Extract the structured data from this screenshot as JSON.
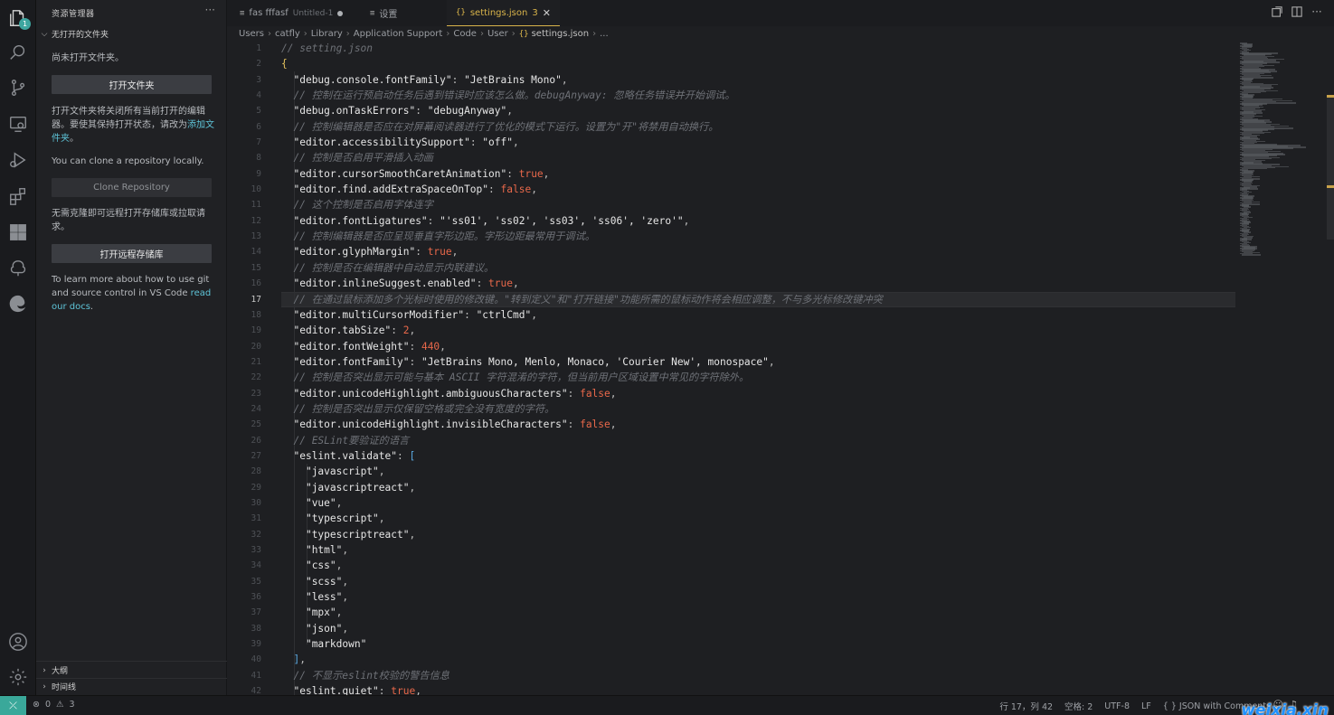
{
  "activity": {
    "explorer_badge": "1",
    "icons": [
      "files-icon",
      "search-icon",
      "source-control-icon",
      "remote-explorer-icon",
      "run-debug-icon",
      "extensions-icon",
      "grid-icon",
      "tree-icon",
      "edge-icon",
      "account-icon",
      "settings-gear-icon"
    ]
  },
  "sidebar": {
    "title": "资源管理器",
    "more": "···",
    "section_title": "无打开的文件夹",
    "no_folder_text": "尚未打开文件夹。",
    "open_folder_btn": "打开文件夹",
    "close_editors_text": "打开文件夹将关闭所有当前打开的编辑器。要使其保持打开状态，请改为",
    "add_folder_link": "添加文件夹",
    "add_folder_suffix": "。",
    "clone_text": "You can clone a repository locally.",
    "clone_btn": "Clone Repository",
    "remote_text": "无需克隆即可远程打开存储库或拉取请求。",
    "remote_btn": "打开远程存储库",
    "learn_text": "To learn more about how to use git and source control in VS Code",
    "read_docs_link": "read our docs",
    "learn_suffix": ".",
    "outline": "大纲",
    "timeline": "时间线"
  },
  "tabs": [
    {
      "icon": "≡",
      "label": "fas fffasf",
      "desc": "Untitled-1",
      "dirty": true
    },
    {
      "icon": "≡",
      "label": "设置"
    },
    {
      "icon": "{}",
      "label": "settings.json",
      "desc": "3",
      "close": "✕"
    }
  ],
  "breadcrumb": {
    "items": [
      "Users",
      "catfly",
      "Library",
      "Application Support",
      "Code",
      "User"
    ],
    "file_icon": "{}",
    "file": "settings.json",
    "tail": "..."
  },
  "editor": {
    "current_line": 17,
    "first_line": 1,
    "lines": [
      [
        [
          "c",
          "// setting.json"
        ]
      ],
      [
        [
          "br",
          "{"
        ]
      ],
      [
        [
          "p",
          "  "
        ],
        [
          "k",
          "\"debug.console.fontFamily\""
        ],
        [
          "p",
          ": "
        ],
        [
          "s",
          "\"JetBrains Mono\""
        ],
        [
          "p",
          ","
        ]
      ],
      [
        [
          "p",
          "  "
        ],
        [
          "c",
          "// 控制在运行预启动任务后遇到错误时应该怎么做。debugAnyway: 忽略任务错误并开始调试。"
        ]
      ],
      [
        [
          "p",
          "  "
        ],
        [
          "k",
          "\"debug.onTaskErrors\""
        ],
        [
          "p",
          ": "
        ],
        [
          "s",
          "\"debugAnyway\""
        ],
        [
          "p",
          ","
        ]
      ],
      [
        [
          "p",
          "  "
        ],
        [
          "c",
          "// 控制编辑器是否应在对屏幕阅读器进行了优化的模式下运行。设置为\"开\"将禁用自动换行。"
        ]
      ],
      [
        [
          "p",
          "  "
        ],
        [
          "k",
          "\"editor.accessibilitySupport\""
        ],
        [
          "p",
          ": "
        ],
        [
          "s",
          "\"off\""
        ],
        [
          "p",
          ","
        ]
      ],
      [
        [
          "p",
          "  "
        ],
        [
          "c",
          "// 控制是否启用平滑插入动画"
        ]
      ],
      [
        [
          "p",
          "  "
        ],
        [
          "k",
          "\"editor.cursorSmoothCaretAnimation\""
        ],
        [
          "p",
          ": "
        ],
        [
          "b",
          "true"
        ],
        [
          "p",
          ","
        ]
      ],
      [
        [
          "p",
          "  "
        ],
        [
          "k",
          "\"editor.find.addExtraSpaceOnTop\""
        ],
        [
          "p",
          ": "
        ],
        [
          "b",
          "false"
        ],
        [
          "p",
          ","
        ]
      ],
      [
        [
          "p",
          "  "
        ],
        [
          "c",
          "// 这个控制是否启用字体连字"
        ]
      ],
      [
        [
          "p",
          "  "
        ],
        [
          "k",
          "\"editor.fontLigatures\""
        ],
        [
          "p",
          ": "
        ],
        [
          "s",
          "\"'ss01', 'ss02', 'ss03', 'ss06', 'zero'\""
        ],
        [
          "p",
          ","
        ]
      ],
      [
        [
          "p",
          "  "
        ],
        [
          "c",
          "// 控制编辑器是否应呈现垂直字形边距。字形边距最常用于调试。"
        ]
      ],
      [
        [
          "p",
          "  "
        ],
        [
          "k",
          "\"editor.glyphMargin\""
        ],
        [
          "p",
          ": "
        ],
        [
          "b",
          "true"
        ],
        [
          "p",
          ","
        ]
      ],
      [
        [
          "p",
          "  "
        ],
        [
          "c",
          "// 控制是否在编辑器中自动显示内联建议。"
        ]
      ],
      [
        [
          "p",
          "  "
        ],
        [
          "k",
          "\"editor.inlineSuggest.enabled\""
        ],
        [
          "p",
          ": "
        ],
        [
          "b",
          "true"
        ],
        [
          "p",
          ","
        ]
      ],
      [
        [
          "p",
          "  "
        ],
        [
          "c",
          "// 在通过鼠标添加多个光标时使用的修改键。\"转到定义\"和\"打开链接\"功能所需的鼠标动作将会相应调整，不与多光标修改键冲突"
        ]
      ],
      [
        [
          "p",
          "  "
        ],
        [
          "k",
          "\"editor.multiCursorModifier\""
        ],
        [
          "p",
          ": "
        ],
        [
          "s",
          "\"ctrlCmd\""
        ],
        [
          "p",
          ","
        ]
      ],
      [
        [
          "p",
          "  "
        ],
        [
          "k",
          "\"editor.tabSize\""
        ],
        [
          "p",
          ": "
        ],
        [
          "n",
          "2"
        ],
        [
          "p",
          ","
        ]
      ],
      [
        [
          "p",
          "  "
        ],
        [
          "k",
          "\"editor.fontWeight\""
        ],
        [
          "p",
          ": "
        ],
        [
          "n",
          "440"
        ],
        [
          "p",
          ","
        ]
      ],
      [
        [
          "p",
          "  "
        ],
        [
          "k",
          "\"editor.fontFamily\""
        ],
        [
          "p",
          ": "
        ],
        [
          "s",
          "\"JetBrains Mono, Menlo, Monaco, 'Courier New', monospace\""
        ],
        [
          "p",
          ","
        ]
      ],
      [
        [
          "p",
          "  "
        ],
        [
          "c",
          "// 控制是否突出显示可能与基本 ASCII 字符混淆的字符，但当前用户区域设置中常见的字符除外。"
        ]
      ],
      [
        [
          "p",
          "  "
        ],
        [
          "k",
          "\"editor.unicodeHighlight.ambiguousCharacters\""
        ],
        [
          "p",
          ": "
        ],
        [
          "b",
          "false"
        ],
        [
          "p",
          ","
        ]
      ],
      [
        [
          "p",
          "  "
        ],
        [
          "c",
          "// 控制是否突出显示仅保留空格或完全没有宽度的字符。"
        ]
      ],
      [
        [
          "p",
          "  "
        ],
        [
          "k",
          "\"editor.unicodeHighlight.invisibleCharacters\""
        ],
        [
          "p",
          ": "
        ],
        [
          "b",
          "false"
        ],
        [
          "p",
          ","
        ]
      ],
      [
        [
          "p",
          "  "
        ],
        [
          "c",
          "// ESLint要验证的语言"
        ]
      ],
      [
        [
          "p",
          "  "
        ],
        [
          "k",
          "\"eslint.validate\""
        ],
        [
          "p",
          ": "
        ],
        [
          "br2",
          "["
        ]
      ],
      [
        [
          "p",
          "    "
        ],
        [
          "s",
          "\"javascript\""
        ],
        [
          "p",
          ","
        ]
      ],
      [
        [
          "p",
          "    "
        ],
        [
          "s",
          "\"javascriptreact\""
        ],
        [
          "p",
          ","
        ]
      ],
      [
        [
          "p",
          "    "
        ],
        [
          "s",
          "\"vue\""
        ],
        [
          "p",
          ","
        ]
      ],
      [
        [
          "p",
          "    "
        ],
        [
          "s",
          "\"typescript\""
        ],
        [
          "p",
          ","
        ]
      ],
      [
        [
          "p",
          "    "
        ],
        [
          "s",
          "\"typescriptreact\""
        ],
        [
          "p",
          ","
        ]
      ],
      [
        [
          "p",
          "    "
        ],
        [
          "s",
          "\"html\""
        ],
        [
          "p",
          ","
        ]
      ],
      [
        [
          "p",
          "    "
        ],
        [
          "s",
          "\"css\""
        ],
        [
          "p",
          ","
        ]
      ],
      [
        [
          "p",
          "    "
        ],
        [
          "s",
          "\"scss\""
        ],
        [
          "p",
          ","
        ]
      ],
      [
        [
          "p",
          "    "
        ],
        [
          "s",
          "\"less\""
        ],
        [
          "p",
          ","
        ]
      ],
      [
        [
          "p",
          "    "
        ],
        [
          "s",
          "\"mpx\""
        ],
        [
          "p",
          ","
        ]
      ],
      [
        [
          "p",
          "    "
        ],
        [
          "s",
          "\"json\""
        ],
        [
          "p",
          ","
        ]
      ],
      [
        [
          "p",
          "    "
        ],
        [
          "s",
          "\"markdown\""
        ]
      ],
      [
        [
          "p",
          "  "
        ],
        [
          "br2",
          "]"
        ],
        [
          "p",
          ","
        ]
      ],
      [
        [
          "p",
          "  "
        ],
        [
          "c",
          "// 不显示eslint校验的警告信息"
        ]
      ],
      [
        [
          "p",
          "  "
        ],
        [
          "k",
          "\"eslint.quiet\""
        ],
        [
          "p",
          ": "
        ],
        [
          "b",
          "true"
        ],
        [
          "p",
          ","
        ]
      ]
    ]
  },
  "status": {
    "remote_icon": "⤫",
    "errors": "0",
    "warnings": "3",
    "position": "行 17，列 42",
    "spaces": "空格: 2",
    "encoding": "UTF-8",
    "eol": "LF",
    "language": "{ } JSON with Comments",
    "watermark": "weixia.xin"
  },
  "colors": {
    "accent": "#d9b44a",
    "remote": "#3aa89a",
    "link": "#5ec4d8",
    "keyword_bool": "#e8684a"
  }
}
